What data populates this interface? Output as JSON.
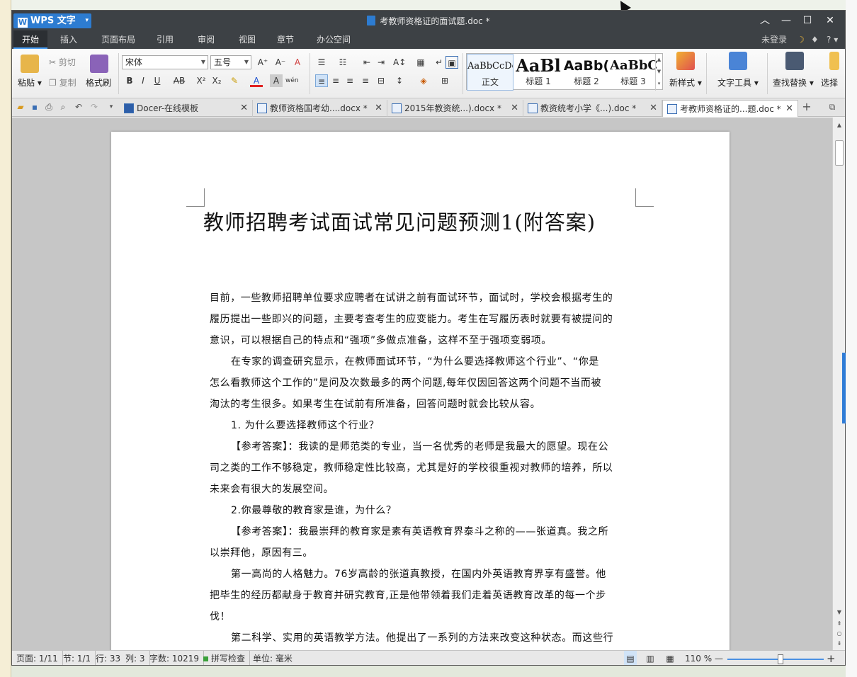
{
  "window": {
    "title": "考教师资格证的面试题.doc *",
    "app_name": "WPS 文字"
  },
  "menu": {
    "items": [
      "开始",
      "插入",
      "页面布局",
      "引用",
      "审阅",
      "视图",
      "章节",
      "办公空间"
    ],
    "login": "未登录",
    "help": "?"
  },
  "ribbon": {
    "paste": "粘贴",
    "cut": "剪切",
    "copy": "复制",
    "format_painter": "格式刷",
    "font_name": "宋体",
    "font_size": "五号",
    "styles": [
      {
        "preview": "AaBbCcDc",
        "label": "正文"
      },
      {
        "preview": "AaBl",
        "label": "标题 1"
      },
      {
        "preview": "AaBb(",
        "label": "标题 2"
      },
      {
        "preview": "AaBbC",
        "label": "标题 3"
      }
    ],
    "new_style": "新样式",
    "text_tools": "文字工具",
    "find_replace": "查找替换",
    "select": "选择"
  },
  "tabs": [
    {
      "label": "Docer-在线模板"
    },
    {
      "label": "教师资格国考幼....docx *"
    },
    {
      "label": "2015年教资统...).docx *"
    },
    {
      "label": "教资统考小学《...).doc *"
    },
    {
      "label": "考教师资格证的...题.doc *"
    }
  ],
  "document": {
    "heading": "教师招聘考试面试常见问题预测1(附答案)",
    "lines": [
      "目前，一些教师招聘单位要求应聘者在试讲之前有面试环节，面试时，学校会根据考生的",
      "履历提出一些即兴的问题，主要考查考生的应变能力。考生在写履历表时就要有被提问的",
      "意识，可以根据自己的特点和“强项”多做点准备，这样不至于强项变弱项。",
      "在专家的调查研究显示，在教师面试环节，“为什么要选择教师这个行业”、“你是",
      "怎么看教师这个工作的”是问及次数最多的两个问题,每年仅因回答这两个问题不当而被",
      "淘汰的考生很多。如果考生在试前有所准备，回答问题时就会比较从容。",
      "1. 为什么要选择教师这个行业？",
      "【参考答案】：我读的是师范类的专业，当一名优秀的老师是我最大的愿望。现在公",
      "司之类的工作不够稳定，教师稳定性比较高，尤其是好的学校很重视对教师的培养，所以",
      "未来会有很大的发展空间。",
      "2.你最尊敬的教育家是谁，为什么？",
      "【参考答案】：我最崇拜的教育家是素有英语教育界泰斗之称的——张道真。我之所",
      "以崇拜他，原因有三。",
      "第一高尚的人格魅力。76岁高龄的张道真教授，在国内外英语教育界享有盛誉。他",
      "把毕生的经历都献身于教育并研究教育,正是他带领着我们走着英语教育改革的每一个步",
      "伐！",
      "第二科学、实用的英语教学方法。他提出了一系列的方法来改变这种状态。而这些行"
    ]
  },
  "status": {
    "page": "页面: 1/11",
    "section": "节: 1/1",
    "row": "行: 33",
    "col": "列: 3",
    "words": "字数: 10219",
    "spell": "拼写检查",
    "unit": "单位: 毫米",
    "zoom": "110 %",
    "zoom_fraction": 0.55
  },
  "colors": {
    "accent": "#2d7cd1",
    "titlebar": "#3d4145"
  }
}
